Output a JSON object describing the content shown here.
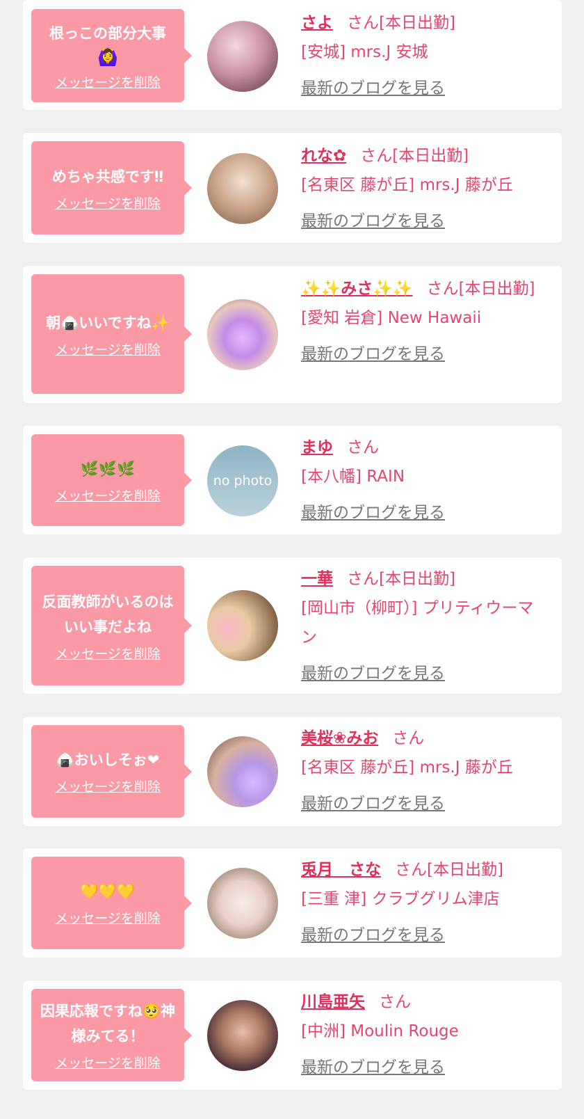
{
  "delete_label": "メッセージを削除",
  "blog_label": "最新のブログを見る",
  "items": [
    {
      "message": "根っこの部分大事",
      "message_emoji": "🙆‍♀️",
      "name": "さよ",
      "suffix": "さん[本日出勤]",
      "shop": "[安城] mrs.J 安城"
    },
    {
      "message": "めちゃ共感です‼︎",
      "message_emoji": "",
      "name": "れな✿",
      "suffix": "さん[本日出勤]",
      "shop": "[名東区 藤が丘] mrs.J 藤が丘"
    },
    {
      "message": "朝🍙いいですね✨",
      "message_emoji": "",
      "name": "✨✨みさ✨✨",
      "suffix": "さん[本日出勤]",
      "shop": "[愛知 岩倉] New Hawaii"
    },
    {
      "message": "🌿🌿🌿",
      "message_emoji": "",
      "name": "まゆ",
      "suffix": "さん",
      "shop": "[本八幡] RAIN"
    },
    {
      "message": "反面教師がいるのはいい事だよね",
      "message_emoji": "",
      "name": "一華",
      "suffix": "さん[本日出勤]",
      "shop": "[岡山市（柳町）] プリティウーマン"
    },
    {
      "message": "🍙おいしそぉ❤",
      "message_emoji": "",
      "name": "美桜❀みお",
      "suffix": "さん",
      "shop": "[名東区 藤が丘] mrs.J 藤が丘"
    },
    {
      "message": "💛💛💛",
      "message_emoji": "",
      "name": "兎月　さな",
      "suffix": "さん[本日出勤]",
      "shop": "[三重 津] クラブグリム津店"
    },
    {
      "message": "因果応報ですね🥺神様みてる！",
      "message_emoji": "",
      "name": "川島亜矢",
      "suffix": "さん",
      "shop": "[中洲] Moulin Rouge"
    }
  ],
  "avatar_placeholder_text": "no photo",
  "colors": {
    "bubble": "#fc99a6",
    "name": "#e0305a",
    "text": "#e8456d",
    "link_gray": "#777777",
    "background": "#f0f0f0"
  }
}
